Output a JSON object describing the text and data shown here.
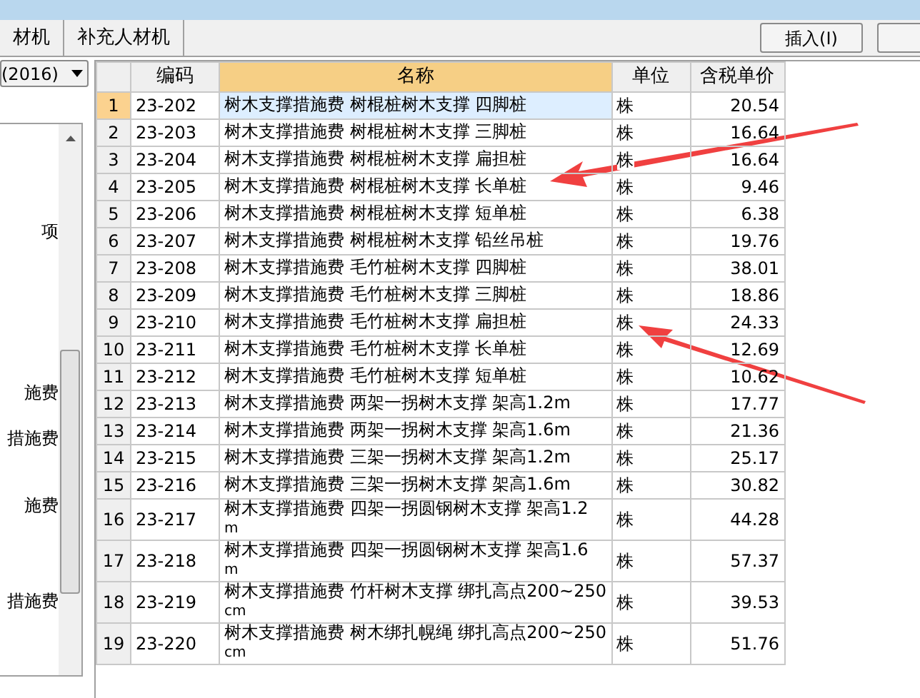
{
  "tabs": [
    {
      "label": "材机",
      "selected": false
    },
    {
      "label": "补充人材机",
      "selected": false
    }
  ],
  "insert_button": "插入(I)",
  "library_select": {
    "value": "(2016)"
  },
  "tree_items": [
    "项",
    "施费",
    "措施费",
    "施费",
    "措施费"
  ],
  "table": {
    "columns": [
      {
        "label": "编码",
        "selected": false
      },
      {
        "label": "名称",
        "selected": true
      },
      {
        "label": "单位",
        "selected": false
      },
      {
        "label": "含税单价",
        "selected": false
      }
    ],
    "rows": [
      {
        "index": "1",
        "code": "23-202",
        "name": [
          "树木支撑措施费 树棍桩树木支撑 四脚桩"
        ],
        "unit": "株",
        "price": "20.54",
        "selected": true
      },
      {
        "index": "2",
        "code": "23-203",
        "name": [
          "树木支撑措施费 树棍桩树木支撑 三脚桩"
        ],
        "unit": "株",
        "price": "16.64",
        "selected": false
      },
      {
        "index": "3",
        "code": "23-204",
        "name": [
          "树木支撑措施费 树棍桩树木支撑 扁担桩"
        ],
        "unit": "株",
        "price": "16.64",
        "selected": false
      },
      {
        "index": "4",
        "code": "23-205",
        "name": [
          "树木支撑措施费 树棍桩树木支撑 长单桩"
        ],
        "unit": "株",
        "price": "9.46",
        "selected": false
      },
      {
        "index": "5",
        "code": "23-206",
        "name": [
          "树木支撑措施费 树棍桩树木支撑 短单桩"
        ],
        "unit": "株",
        "price": "6.38",
        "selected": false
      },
      {
        "index": "6",
        "code": "23-207",
        "name": [
          "树木支撑措施费 树棍桩树木支撑 铅丝吊桩"
        ],
        "unit": "株",
        "price": "19.76",
        "selected": false
      },
      {
        "index": "7",
        "code": "23-208",
        "name": [
          "树木支撑措施费 毛竹桩树木支撑 四脚桩"
        ],
        "unit": "株",
        "price": "38.01",
        "selected": false
      },
      {
        "index": "8",
        "code": "23-209",
        "name": [
          "树木支撑措施费 毛竹桩树木支撑 三脚桩"
        ],
        "unit": "株",
        "price": "18.86",
        "selected": false
      },
      {
        "index": "9",
        "code": "23-210",
        "name": [
          "树木支撑措施费 毛竹桩树木支撑 扁担桩"
        ],
        "unit": "株",
        "price": "24.33",
        "selected": false
      },
      {
        "index": "10",
        "code": "23-211",
        "name": [
          "树木支撑措施费 毛竹桩树木支撑 长单桩"
        ],
        "unit": "株",
        "price": "12.69",
        "selected": false
      },
      {
        "index": "11",
        "code": "23-212",
        "name": [
          "树木支撑措施费 毛竹桩树木支撑 短单桩"
        ],
        "unit": "株",
        "price": "10.62",
        "selected": false
      },
      {
        "index": "12",
        "code": "23-213",
        "name": [
          "树木支撑措施费 两架一拐树木支撑 架高1.2m"
        ],
        "unit": "株",
        "price": "17.77",
        "selected": false
      },
      {
        "index": "13",
        "code": "23-214",
        "name": [
          "树木支撑措施费 两架一拐树木支撑 架高1.6m"
        ],
        "unit": "株",
        "price": "21.36",
        "selected": false
      },
      {
        "index": "14",
        "code": "23-215",
        "name": [
          "树木支撑措施费 三架一拐树木支撑 架高1.2m"
        ],
        "unit": "株",
        "price": "25.17",
        "selected": false
      },
      {
        "index": "15",
        "code": "23-216",
        "name": [
          "树木支撑措施费 三架一拐树木支撑 架高1.6m"
        ],
        "unit": "株",
        "price": "30.82",
        "selected": false
      },
      {
        "index": "16",
        "code": "23-217",
        "name": [
          "树木支撑措施费 四架一拐圆钢树木支撑 架高1.2",
          "m"
        ],
        "unit": "株",
        "price": "44.28",
        "selected": false
      },
      {
        "index": "17",
        "code": "23-218",
        "name": [
          "树木支撑措施费 四架一拐圆钢树木支撑 架高1.6",
          "m"
        ],
        "unit": "株",
        "price": "57.37",
        "selected": false
      },
      {
        "index": "18",
        "code": "23-219",
        "name": [
          "树木支撑措施费 竹杆树木支撑 绑扎高点200~250",
          "cm"
        ],
        "unit": "株",
        "price": "39.53",
        "selected": false
      },
      {
        "index": "19",
        "code": "23-220",
        "name": [
          "树木支撑措施费 树木绑扎幌绳 绑扎高点200~250",
          "cm"
        ],
        "unit": "株",
        "price": "51.76",
        "selected": false
      }
    ]
  }
}
